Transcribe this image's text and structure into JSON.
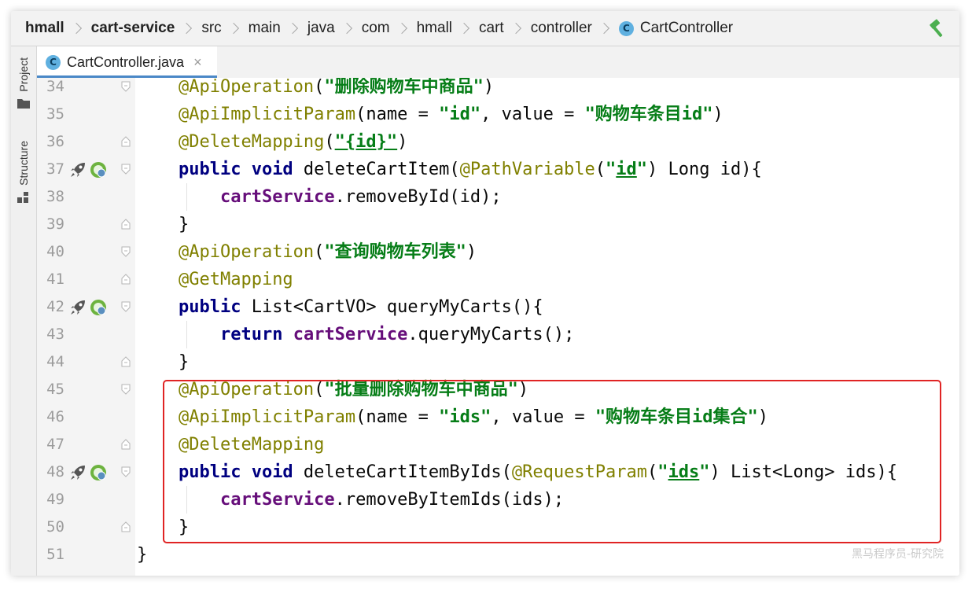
{
  "breadcrumb": {
    "items": [
      "hmall",
      "cart-service",
      "src",
      "main",
      "java",
      "com",
      "hmall",
      "cart",
      "controller",
      "CartController"
    ],
    "class_badge": "C"
  },
  "toolbar": {
    "build_icon": "hammer-icon"
  },
  "tool_windows": {
    "project": "Project",
    "structure": "Structure"
  },
  "editor_tab": {
    "title": "CartController.java",
    "badge": "C",
    "close": "×"
  },
  "editor": {
    "lines": [
      {
        "n": "34",
        "parts": [
          [
            "",
            "    "
          ],
          [
            "an",
            "@ApiOperation"
          ],
          [
            "",
            "("
          ],
          [
            "st",
            "\"删除购物车中商品\""
          ],
          [
            "",
            ")"
          ]
        ]
      },
      {
        "n": "35",
        "parts": [
          [
            "",
            "    "
          ],
          [
            "an",
            "@ApiImplicitParam"
          ],
          [
            "",
            "(name = "
          ],
          [
            "st",
            "\"id\""
          ],
          [
            "",
            ", value = "
          ],
          [
            "st",
            "\"购物车条目id\""
          ],
          [
            "",
            ")"
          ]
        ]
      },
      {
        "n": "36",
        "parts": [
          [
            "",
            "    "
          ],
          [
            "an",
            "@DeleteMapping"
          ],
          [
            "",
            "("
          ],
          [
            "st ul",
            "\"{id}\""
          ],
          [
            "",
            ")"
          ]
        ]
      },
      {
        "n": "37",
        "parts": [
          [
            "",
            "    "
          ],
          [
            "kw",
            "public void"
          ],
          [
            "",
            " deleteCartItem("
          ],
          [
            "an",
            "@PathVariable"
          ],
          [
            "",
            "("
          ],
          [
            "st",
            "\""
          ],
          [
            "st ul",
            "id"
          ],
          [
            "st",
            "\""
          ],
          [
            "",
            ") Long id){"
          ]
        ]
      },
      {
        "n": "38",
        "parts": [
          [
            "",
            "        "
          ],
          [
            "fd",
            "cartService"
          ],
          [
            "",
            ".removeById(id);"
          ]
        ]
      },
      {
        "n": "39",
        "parts": [
          [
            "",
            "    }"
          ]
        ]
      },
      {
        "n": "40",
        "parts": [
          [
            "",
            "    "
          ],
          [
            "an",
            "@ApiOperation"
          ],
          [
            "",
            "("
          ],
          [
            "st",
            "\"查询购物车列表\""
          ],
          [
            "",
            ")"
          ]
        ]
      },
      {
        "n": "41",
        "parts": [
          [
            "",
            "    "
          ],
          [
            "an",
            "@GetMapping"
          ]
        ]
      },
      {
        "n": "42",
        "parts": [
          [
            "",
            "    "
          ],
          [
            "kw",
            "public"
          ],
          [
            "",
            " List<CartVO> queryMyCarts(){"
          ]
        ]
      },
      {
        "n": "43",
        "parts": [
          [
            "",
            "        "
          ],
          [
            "kw",
            "return"
          ],
          [
            "",
            " "
          ],
          [
            "fd",
            "cartService"
          ],
          [
            "",
            ".queryMyCarts();"
          ]
        ]
      },
      {
        "n": "44",
        "parts": [
          [
            "",
            "    }"
          ]
        ]
      },
      {
        "n": "45",
        "parts": [
          [
            "",
            "    "
          ],
          [
            "an",
            "@ApiOperation"
          ],
          [
            "",
            "("
          ],
          [
            "st",
            "\"批量删除购物车中商品\""
          ],
          [
            "",
            ")"
          ]
        ]
      },
      {
        "n": "46",
        "parts": [
          [
            "",
            "    "
          ],
          [
            "an",
            "@ApiImplicitParam"
          ],
          [
            "",
            "(name = "
          ],
          [
            "st",
            "\"ids\""
          ],
          [
            "",
            ", value = "
          ],
          [
            "st",
            "\"购物车条目id集合\""
          ],
          [
            "",
            ")"
          ]
        ]
      },
      {
        "n": "47",
        "parts": [
          [
            "",
            "    "
          ],
          [
            "an",
            "@DeleteMapping"
          ]
        ]
      },
      {
        "n": "48",
        "parts": [
          [
            "",
            "    "
          ],
          [
            "kw",
            "public void"
          ],
          [
            "",
            " deleteCartItemByIds("
          ],
          [
            "an",
            "@RequestParam"
          ],
          [
            "",
            "("
          ],
          [
            "st",
            "\""
          ],
          [
            "st ul",
            "ids"
          ],
          [
            "st",
            "\""
          ],
          [
            "",
            ") List<Long> ids){"
          ]
        ]
      },
      {
        "n": "49",
        "parts": [
          [
            "",
            "        "
          ],
          [
            "fd",
            "cartService"
          ],
          [
            "",
            ".removeByItemIds(ids);"
          ]
        ]
      },
      {
        "n": "50",
        "parts": [
          [
            "",
            "    }"
          ]
        ]
      },
      {
        "n": "51",
        "parts": [
          [
            "",
            "}"
          ]
        ]
      }
    ],
    "gutter_markers": {
      "37": [
        "run-icon",
        "spring-bean-icon"
      ],
      "42": [
        "run-icon",
        "spring-bean-icon"
      ],
      "48": [
        "run-icon",
        "spring-bean-icon"
      ]
    }
  },
  "colors": {
    "keyword": "#000080",
    "annotation": "#808000",
    "string": "#067d17",
    "field": "#660e7a",
    "highlight_box": "#e02424"
  },
  "watermark": "黑马程序员-研究院"
}
